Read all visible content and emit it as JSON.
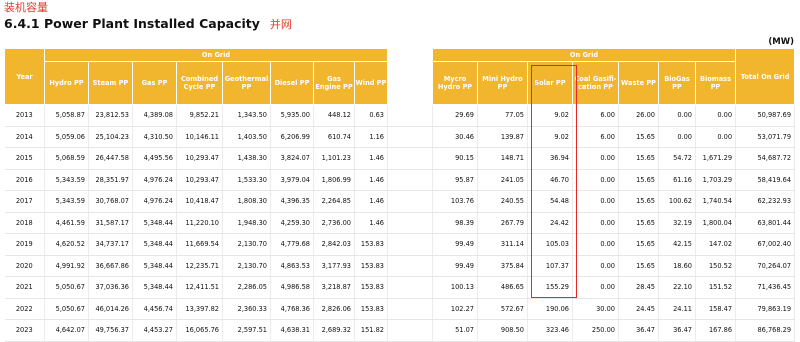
{
  "annotation": "装机容量",
  "title": "6.4.1 Power Plant Installed Capacity",
  "title_note": "并网",
  "units": "(MW)",
  "table": {
    "year_header": "Year",
    "group_left": "On Grid",
    "group_right": "On Grid",
    "total_header": "Total On Grid",
    "left_columns": [
      "Hydro PP",
      "Steam PP",
      "Gas PP",
      "Combined Cycle PP",
      "Geothermal PP",
      "Diesel PP",
      "Gas Engine PP",
      "Wind PP"
    ],
    "right_columns": [
      "Mycro Hydro PP",
      "Mini Hydro PP",
      "Solar PP",
      "Coal Gasifi-cation PP",
      "Waste PP",
      "BioGas PP",
      "Biomass PP"
    ],
    "rows": [
      {
        "year": "2013",
        "left": [
          "5,058.87",
          "23,812.53",
          "4,389.08",
          "9,852.21",
          "1,343.50",
          "5,935.00",
          "448.12",
          "0.63"
        ],
        "right": [
          "29.69",
          "77.05",
          "9.02",
          "6.00",
          "26.00",
          "0.00",
          "0.00"
        ],
        "total": "50,987.69"
      },
      {
        "year": "2014",
        "left": [
          "5,059.06",
          "25,104.23",
          "4,310.50",
          "10,146.11",
          "1,403.50",
          "6,206.99",
          "610.74",
          "1.16"
        ],
        "right": [
          "30.46",
          "139.87",
          "9.02",
          "6.00",
          "15.65",
          "0.00",
          "0.00"
        ],
        "total": "53,071.79"
      },
      {
        "year": "2015",
        "left": [
          "5,068.59",
          "26,447.58",
          "4,495.56",
          "10,293.47",
          "1,438.30",
          "3,824.07",
          "1,101.23",
          "1.46"
        ],
        "right": [
          "90.15",
          "148.71",
          "36.94",
          "0.00",
          "15.65",
          "54.72",
          "1,671.29"
        ],
        "total": "54,687.72"
      },
      {
        "year": "2016",
        "left": [
          "5,343.59",
          "28,351.97",
          "4,976.24",
          "10,293.47",
          "1,533.30",
          "3,979.04",
          "1,806.99",
          "1.46"
        ],
        "right": [
          "95.87",
          "241.05",
          "46.70",
          "0.00",
          "15.65",
          "61.16",
          "1,703.29"
        ],
        "total": "58,419.64"
      },
      {
        "year": "2017",
        "left": [
          "5,343.59",
          "30,768.07",
          "4,976.24",
          "10,418.47",
          "1,808.30",
          "4,396.35",
          "2,264.85",
          "1.46"
        ],
        "right": [
          "103.76",
          "240.55",
          "54.48",
          "0.00",
          "15.65",
          "100.62",
          "1,740.54"
        ],
        "total": "62,232.93"
      },
      {
        "year": "2018",
        "left": [
          "4,461.59",
          "31,587.17",
          "5,348.44",
          "11,220.10",
          "1,948.30",
          "4,259.30",
          "2,736.00",
          "1.46"
        ],
        "right": [
          "98.39",
          "267.79",
          "24.42",
          "0.00",
          "15.65",
          "32.19",
          "1,800.04"
        ],
        "total": "63,801.44"
      },
      {
        "year": "2019",
        "left": [
          "4,620.52",
          "34,737.17",
          "5,348.44",
          "11,669.54",
          "2,130.70",
          "4,779.68",
          "2,842.03",
          "153.83"
        ],
        "right": [
          "99.49",
          "311.14",
          "105.03",
          "0.00",
          "15.65",
          "42.15",
          "147.02"
        ],
        "total": "67,002.40"
      },
      {
        "year": "2020",
        "left": [
          "4,991.92",
          "36,667.86",
          "5,348.44",
          "12,235.71",
          "2,130.70",
          "4,863.53",
          "3,177.93",
          "153.83"
        ],
        "right": [
          "99.49",
          "375.84",
          "107.37",
          "0.00",
          "15.65",
          "18.60",
          "150.52"
        ],
        "total": "70,264.07"
      },
      {
        "year": "2021",
        "left": [
          "5,050.67",
          "37,036.36",
          "5,348.44",
          "12,411.51",
          "2,286.05",
          "4,986.58",
          "3,218.87",
          "153.83"
        ],
        "right": [
          "100.13",
          "486.65",
          "155.29",
          "0.00",
          "28.45",
          "22.10",
          "151.52"
        ],
        "total": "71,436.45"
      },
      {
        "year": "2022",
        "left": [
          "5,050.67",
          "46,014.26",
          "4,456.74",
          "13,397.82",
          "2,360.33",
          "4,768.36",
          "2,826.06",
          "153.83"
        ],
        "right": [
          "102.27",
          "572.67",
          "190.06",
          "30.00",
          "24.45",
          "24.11",
          "158.47"
        ],
        "total": "79,863.19"
      },
      {
        "year": "2023",
        "left": [
          "4,642.07",
          "49,756.37",
          "4,453.27",
          "16,065.76",
          "2,597.51",
          "4,638.31",
          "2,689.32",
          "151.82"
        ],
        "right": [
          "51.07",
          "908.50",
          "323.46",
          "250.00",
          "36.47",
          "36.47",
          "167.86"
        ],
        "total": "86,768.29"
      }
    ]
  },
  "highlight_color": "#e62a2a",
  "header_color": "#f1b52e"
}
